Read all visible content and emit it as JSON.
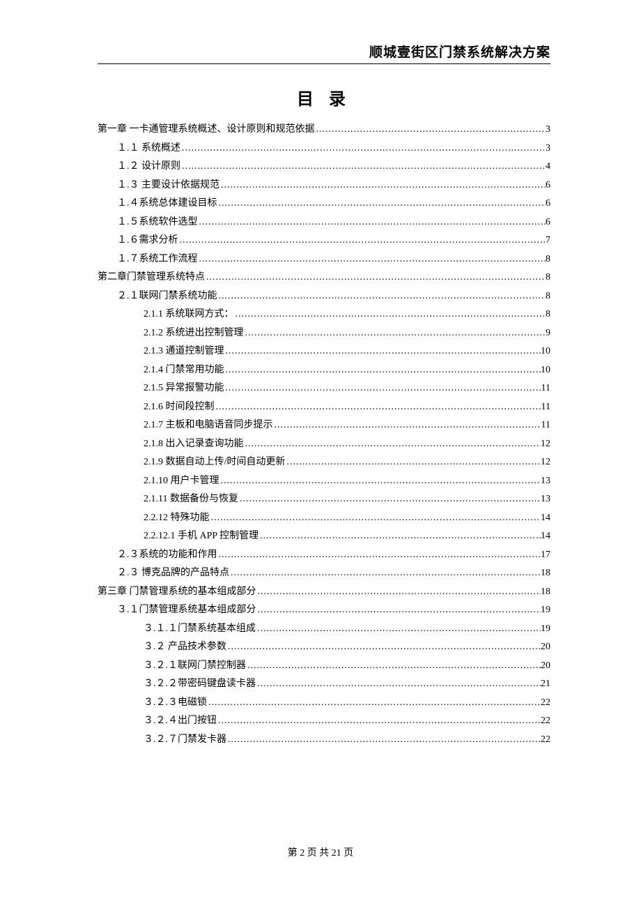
{
  "header": {
    "title": "顺城壹街区门禁系统解决方案"
  },
  "toc": {
    "title": "目 录",
    "entries": [
      {
        "level": 0,
        "label": "第一章   一卡通管理系统概述、设计原则和规范依据",
        "page": "3"
      },
      {
        "level": 1,
        "label": "１.１ 系统概述",
        "page": "3"
      },
      {
        "level": 1,
        "label": "１.２ 设计原则",
        "page": "4"
      },
      {
        "level": 1,
        "label": "１.３ 主要设计依据规范",
        "page": "6"
      },
      {
        "level": 1,
        "label": "１.４系统总体建设目标",
        "page": "6"
      },
      {
        "level": 1,
        "label": "１.５系统软件选型",
        "page": "6"
      },
      {
        "level": 1,
        "label": "１.６需求分析",
        "page": "7"
      },
      {
        "level": 1,
        "label": "１.７系统工作流程",
        "page": "8"
      },
      {
        "level": 0,
        "label": "第二章门禁管理系统特点",
        "page": "8"
      },
      {
        "level": 1,
        "label": "２.１联网门禁系统功能",
        "page": "8"
      },
      {
        "level": 2,
        "label": "2.1.1 系统联网方式：",
        "page": "8"
      },
      {
        "level": 2,
        "label": "2.1.2 系统进出控制管理",
        "page": "9"
      },
      {
        "level": 2,
        "label": "2.1.3 通道控制管理",
        "page": "10"
      },
      {
        "level": 2,
        "label": "2.1.4 门禁常用功能",
        "page": "10"
      },
      {
        "level": 2,
        "label": "2.1.5 异常报警功能",
        "page": "11"
      },
      {
        "level": 2,
        "label": "2.1.6 时间段控制",
        "page": "11"
      },
      {
        "level": 2,
        "label": "2.1.7 主板和电脑语音同步提示",
        "page": "11"
      },
      {
        "level": 2,
        "label": "2.1.8 出入记录查询功能",
        "page": "12"
      },
      {
        "level": 2,
        "label": "2.1.9 数据自动上传/时间自动更新",
        "page": "12"
      },
      {
        "level": 2,
        "label": "2.1.10 用户卡管理",
        "page": "13"
      },
      {
        "level": 2,
        "label": "2.1.11 数据备份与恢复",
        "page": "13"
      },
      {
        "level": 2,
        "label": "2.2.12 特殊功能",
        "page": "14"
      },
      {
        "level": 2,
        "label": "2.2.12.1 手机 APP 控制管理",
        "page": "14"
      },
      {
        "level": 1,
        "label": "２.３系统的功能和作用",
        "page": "17"
      },
      {
        "level": 1,
        "label": "２.３ 博克品牌的产品特点",
        "page": "18"
      },
      {
        "level": 0,
        "label": "第三章 门禁管理系统的基本组成部分",
        "page": "18"
      },
      {
        "level": 1,
        "label": "３.１门禁管理系统基本组成部分",
        "page": "19"
      },
      {
        "level": 2,
        "label": "３.１.１门禁系统基本组成",
        "page": "19"
      },
      {
        "level": 2,
        "label": "３.２ 产品技术参数",
        "page": "20"
      },
      {
        "level": 2,
        "label": "３.２.１联网门禁控制器",
        "page": "20"
      },
      {
        "level": 2,
        "label": "３.２.２带密码键盘读卡器",
        "page": "21"
      },
      {
        "level": 2,
        "label": "３.２.３电磁锁",
        "page": "22"
      },
      {
        "level": 2,
        "label": "３.２.４出门按钮",
        "page": "22"
      },
      {
        "level": 2,
        "label": "３.２.７门禁发卡器",
        "page": "22"
      }
    ]
  },
  "footer": {
    "text": "第 2 页 共 21 页"
  }
}
